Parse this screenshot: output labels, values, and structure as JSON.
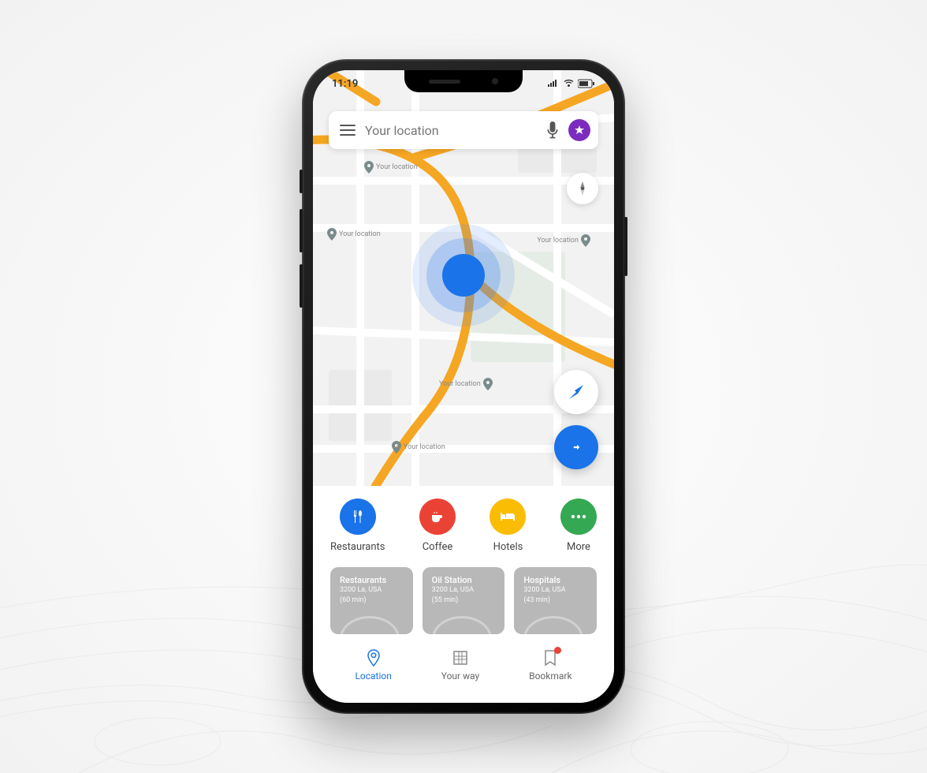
{
  "status": {
    "time": "11:19"
  },
  "search": {
    "placeholder": "Your location"
  },
  "map": {
    "labels": [
      "Your location",
      "Your location",
      "Your location",
      "Your location",
      "Your location"
    ]
  },
  "categories": [
    {
      "label": "Restaurants",
      "color": "blue",
      "icon": "fork-knife"
    },
    {
      "label": "Coffee",
      "color": "red",
      "icon": "cup"
    },
    {
      "label": "Hotels",
      "color": "yellow",
      "icon": "bed"
    },
    {
      "label": "More",
      "color": "green",
      "icon": "dots"
    }
  ],
  "places": [
    {
      "title": "Restaurants",
      "address": "3200 La, USA",
      "time": "(60 min)"
    },
    {
      "title": "Oil Station",
      "address": "3200 La, USA",
      "time": "(55 min)"
    },
    {
      "title": "Hospitals",
      "address": "3200 La, USA",
      "time": "(43 min)"
    }
  ],
  "nav": [
    {
      "label": "Location",
      "active": true
    },
    {
      "label": "Your way",
      "active": false
    },
    {
      "label": "Bookmark",
      "active": false,
      "badge": true
    }
  ]
}
